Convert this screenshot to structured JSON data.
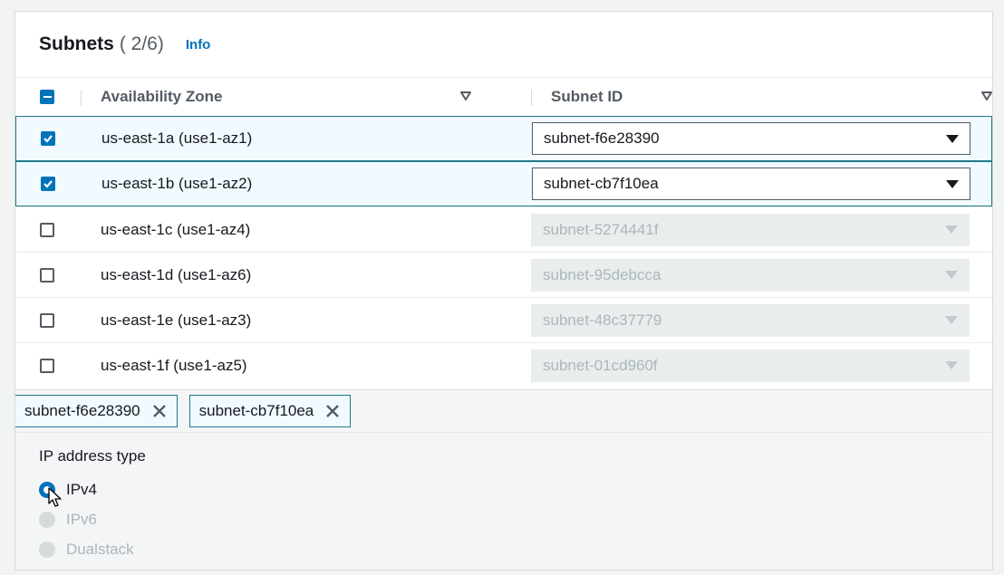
{
  "panel": {
    "title": "Subnets",
    "count": "( 2/6)",
    "info_label": "Info"
  },
  "table": {
    "columns": {
      "az": "Availability Zone",
      "subnet": "Subnet ID"
    },
    "rows": [
      {
        "az": "us-east-1a (use1-az1)",
        "subnet": "subnet-f6e28390",
        "checked": true
      },
      {
        "az": "us-east-1b (use1-az2)",
        "subnet": "subnet-cb7f10ea",
        "checked": true
      },
      {
        "az": "us-east-1c (use1-az4)",
        "subnet": "subnet-5274441f",
        "checked": false
      },
      {
        "az": "us-east-1d (use1-az6)",
        "subnet": "subnet-95debcca",
        "checked": false
      },
      {
        "az": "us-east-1e (use1-az3)",
        "subnet": "subnet-48c37779",
        "checked": false
      },
      {
        "az": "us-east-1f (use1-az5)",
        "subnet": "subnet-01cd960f",
        "checked": false
      }
    ]
  },
  "tokens": [
    "subnet-f6e28390",
    "subnet-cb7f10ea"
  ],
  "ip_address_type": {
    "label": "IP address type",
    "options": [
      {
        "label": "IPv4",
        "selected": true,
        "disabled": false
      },
      {
        "label": "IPv6",
        "selected": false,
        "disabled": true
      },
      {
        "label": "Dualstack",
        "selected": false,
        "disabled": true
      }
    ]
  },
  "colors": {
    "accent": "#0073bb",
    "selected_border": "#1f7a8c",
    "selected_bg": "#f1faff"
  }
}
